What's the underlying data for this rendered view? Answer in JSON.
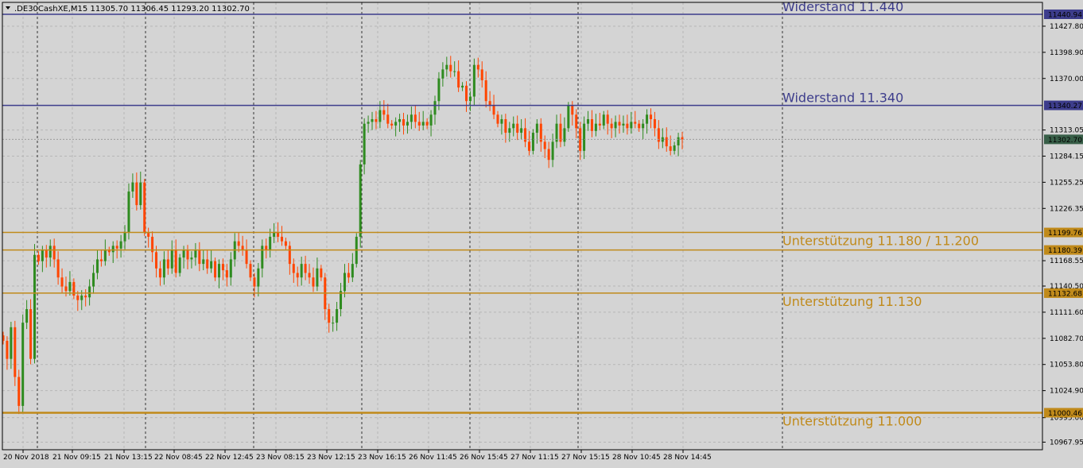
{
  "header": {
    "dropdown_icon": "triangle-down-icon",
    "symbol_text": ".DE30CashXE,M15  11305.70 11306.45 11293.20 11302.70"
  },
  "colors": {
    "background": "#d4d4d4",
    "grid": "#b6b6b6",
    "bull": "#2e8b1f",
    "bear": "#ff4500",
    "resistance": "#3d3d8c",
    "support": "#c08a1a",
    "current_price_bg": "#385f48"
  },
  "chart_data": {
    "type": "candlestick",
    "symbol": ".DE30CashXE",
    "timeframe": "M15",
    "ohlc_current": {
      "open": 11305.7,
      "high": 11306.45,
      "low": 11293.2,
      "close": 11302.7
    },
    "ylim": [
      10960,
      11450
    ],
    "y_ticks": [
      "11427.80",
      "11398.90",
      "11370.00",
      "11313.05",
      "11284.15",
      "11255.25",
      "11226.35",
      "11168.55",
      "11140.50",
      "11111.60",
      "11082.70",
      "11053.80",
      "11024.90",
      "10995.00",
      "10967.95"
    ],
    "x_labels": [
      "20 Nov 2018",
      "21 Nov 09:15",
      "21 Nov 13:15",
      "22 Nov 08:45",
      "22 Nov 12:45",
      "23 Nov 08:15",
      "23 Nov 12:15",
      "23 Nov 16:15",
      "26 Nov 11:45",
      "26 Nov 15:45",
      "27 Nov 11:15",
      "27 Nov 15:15",
      "28 Nov 10:45",
      "28 Nov 14:45"
    ],
    "grid": true,
    "current_price": "11302.70",
    "levels": [
      {
        "kind": "resistance",
        "price": 11440.94,
        "tag": "11440.94",
        "label": "Widerstand 11.440"
      },
      {
        "kind": "resistance",
        "price": 11340.27,
        "tag": "11340.27",
        "label": "Widerstand 11.340"
      },
      {
        "kind": "support",
        "price": 11199.76,
        "tag": "11199.76",
        "label": "Unterstützung 11.180 / 11.200"
      },
      {
        "kind": "support",
        "price": 11180.39,
        "tag": "11180.39",
        "label": ""
      },
      {
        "kind": "support",
        "price": 11132.68,
        "tag": "11132.68",
        "label": "Unterstützung 11.130"
      },
      {
        "kind": "support",
        "price": 11000.46,
        "tag": "11000.46",
        "label": "Unterstützung 11.000"
      }
    ],
    "close_series": [
      11080,
      11060,
      11095,
      11040,
      11008,
      11100,
      11115,
      11060,
      11175,
      11168,
      11180,
      11172,
      11185,
      11170,
      11150,
      11140,
      11135,
      11145,
      11130,
      11125,
      11130,
      11128,
      11140,
      11155,
      11170,
      11168,
      11180,
      11178,
      11185,
      11182,
      11190,
      11200,
      11245,
      11255,
      11230,
      11255,
      11200,
      11195,
      11178,
      11160,
      11150,
      11170,
      11160,
      11180,
      11155,
      11172,
      11180,
      11170,
      11172,
      11180,
      11165,
      11170,
      11160,
      11168,
      11150,
      11165,
      11158,
      11150,
      11170,
      11190,
      11185,
      11180,
      11165,
      11150,
      11140,
      11160,
      11185,
      11180,
      11195,
      11200,
      11195,
      11190,
      11185,
      11165,
      11155,
      11150,
      11165,
      11155,
      11150,
      11140,
      11160,
      11150,
      11115,
      11100,
      11100,
      11115,
      11135,
      11155,
      11150,
      11165,
      11195,
      11275,
      11320,
      11322,
      11325,
      11322,
      11335,
      11330,
      11320,
      11318,
      11322,
      11325,
      11318,
      11322,
      11330,
      11322,
      11318,
      11322,
      11318,
      11330,
      11345,
      11370,
      11380,
      11385,
      11378,
      11378,
      11360,
      11362,
      11345,
      11350,
      11385,
      11380,
      11368,
      11345,
      11340,
      11330,
      11320,
      11325,
      11310,
      11315,
      11320,
      11310,
      11315,
      11300,
      11290,
      11310,
      11320,
      11300,
      11292,
      11280,
      11300,
      11320,
      11300,
      11315,
      11340,
      11330,
      11315,
      11290,
      11320,
      11325,
      11312,
      11320,
      11318,
      11330,
      11320,
      11315,
      11322,
      11318,
      11320,
      11315,
      11322,
      11320,
      11315,
      11320,
      11330,
      11325,
      11315,
      11300,
      11305,
      11295,
      11290,
      11296,
      11305,
      11302.7
    ],
    "candle_count": 180
  }
}
